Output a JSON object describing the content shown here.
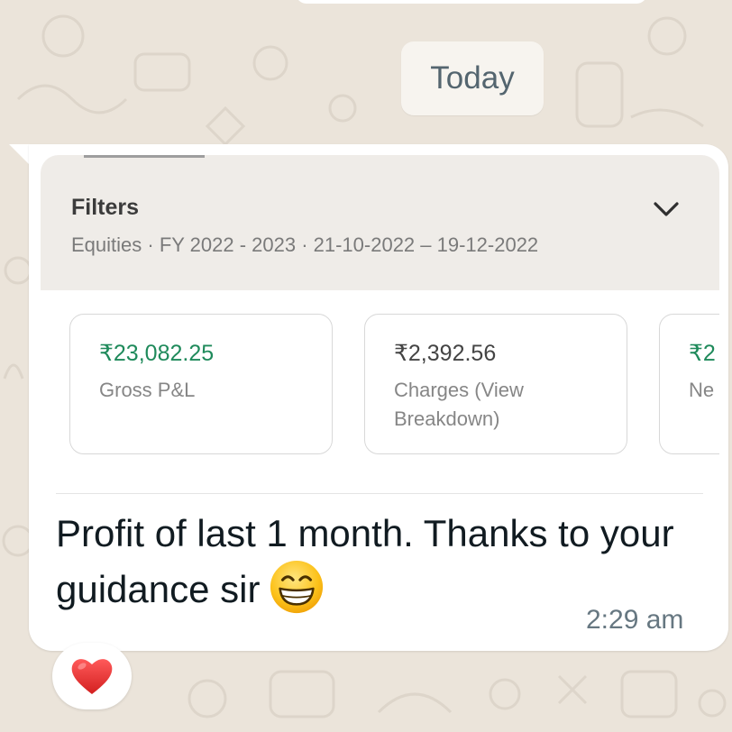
{
  "date_chip": "Today",
  "message": {
    "screenshot": {
      "filters": {
        "title": "Filters",
        "summary": "Equities · FY 2022 - 2023 · 21-10-2022 – 19-12-2022",
        "expand_icon": "chevron-down-icon"
      },
      "cards": [
        {
          "value": "₹23,082.25",
          "label": "Gross P&L",
          "value_color": "#1f8a5b"
        },
        {
          "value": "₹2,392.56",
          "label": "Charges (View Breakdown)",
          "value_color": "#444444"
        },
        {
          "value": "₹2",
          "label": "Ne",
          "value_color": "#1f8a5b"
        }
      ]
    },
    "text": "Profit of last 1 month. Thanks to your guidance sir",
    "emoji": "grinning-face-with-smiling-eyes",
    "time": "2:29 am",
    "reaction": "red-heart"
  },
  "colors": {
    "chat_background": "#ebe4da",
    "bubble": "#ffffff",
    "profit_green": "#1f8a5b",
    "reaction_heart": "#e53935"
  }
}
